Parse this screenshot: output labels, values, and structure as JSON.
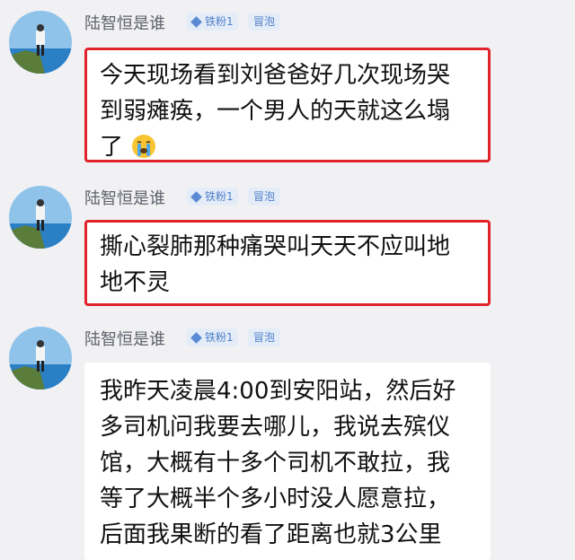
{
  "messages": [
    {
      "user": "陆智恒是谁",
      "fan_badge": "铁粉1",
      "bubble_badge": "冒泡",
      "lines": [
        "今天现场看到刘爸爸好几次现场哭",
        "到弱瘫痪，一个男人的天就这么塌",
        "了"
      ],
      "emoji": "crying-face-icon"
    },
    {
      "user": "陆智恒是谁",
      "fan_badge": "铁粉1",
      "bubble_badge": "冒泡",
      "lines": [
        "撕心裂肺那种痛哭叫天天不应叫地",
        "地不灵"
      ]
    },
    {
      "user": "陆智恒是谁",
      "fan_badge": "铁粉1",
      "bubble_badge": "冒泡",
      "lines": [
        "我昨天凌晨4:00到安阳站，然后好",
        "多司机问我要去哪儿，我说去殡仪",
        "馆，大概有十多个司机不敢拉，我",
        "等了大概半个多小时没人愿意拉，",
        "后面我果断的看了距离也就3公里"
      ]
    }
  ],
  "colors": {
    "highlight_border": "#e0222a",
    "badge_text": "#4f80c8",
    "badge_bg": "#e4ecf8"
  }
}
